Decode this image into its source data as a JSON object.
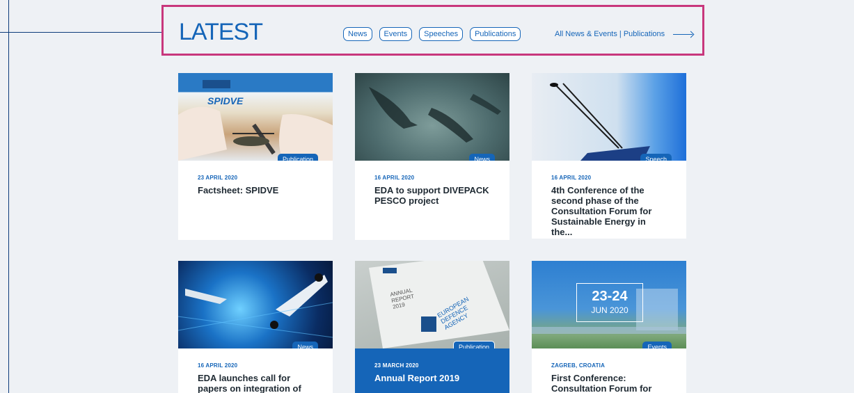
{
  "section": {
    "title": "LATEST",
    "filters": [
      "News",
      "Events",
      "Speeches",
      "Publications"
    ],
    "all_link": "All News & Events | Publications"
  },
  "colors": {
    "accent": "#1565b8",
    "highlight_border": "#c8377c",
    "background": "#eef1f5"
  },
  "cards": [
    {
      "badge": "Publication",
      "date": "23 APRIL 2020",
      "title": "Factsheet: SPIDVE",
      "image_text": "SPIDVE"
    },
    {
      "badge": "News",
      "date": "16 APRIL 2020",
      "title": "EDA to support DIVEPACK PESCO project"
    },
    {
      "badge": "Speech",
      "date": "16 APRIL 2020",
      "title": "4th Conference of the second phase of the Consultation Forum for Sustainable Energy in the..."
    },
    {
      "badge": "News",
      "date": "16 APRIL 2020",
      "title": "EDA launches call for papers on integration of"
    },
    {
      "badge": "Publication",
      "date": "23 MARCH 2020",
      "title": "Annual Report 2019",
      "image_text_1": "ANNUAL REPORT 2019",
      "image_text_2": "EUROPEAN DEFENCE AGENCY"
    },
    {
      "badge": "Events",
      "date": "ZAGREB, CROATIA",
      "title": "First Conference: Consultation Forum for",
      "image_date_1": "23-24",
      "image_date_2": "JUN 2020"
    }
  ]
}
